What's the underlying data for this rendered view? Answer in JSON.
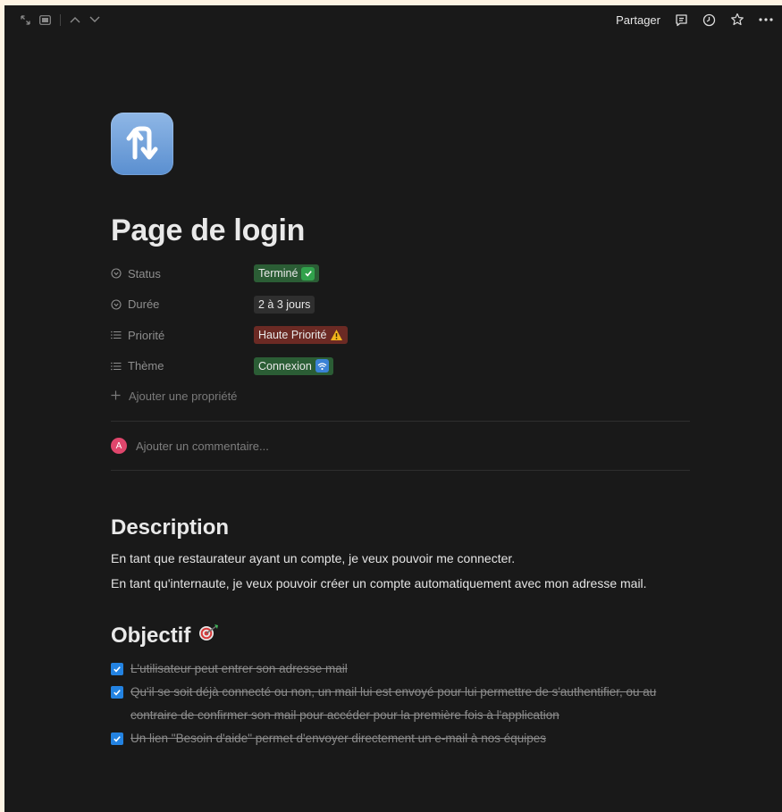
{
  "topbar": {
    "share_label": "Partager",
    "icons": [
      "expand-icon",
      "sidebar-icon",
      "chevron-up-icon",
      "chevron-down-icon",
      "comment-icon",
      "history-icon",
      "star-icon",
      "more-icon"
    ]
  },
  "page": {
    "icon": "repeat-arrows-icon",
    "title": "Page de login"
  },
  "properties": [
    {
      "name": "Status",
      "icon": "status-icon",
      "value": "Terminé",
      "emoji": "✓",
      "tag_color": "#2b5d35",
      "emoji_color": "#31a24c"
    },
    {
      "name": "Durée",
      "icon": "status-icon",
      "value": "2 à 3 jours",
      "emoji": "",
      "tag_color": "#2f2f2f",
      "emoji_color": ""
    },
    {
      "name": "Priorité",
      "icon": "list-icon",
      "value": "Haute Priorité",
      "emoji": "⚠",
      "tag_color": "#6b2a24",
      "emoji_color": "#f2b41c"
    },
    {
      "name": "Thème",
      "icon": "list-icon",
      "value": "Connexion",
      "emoji": "wifi",
      "tag_color": "#2b5d35",
      "emoji_color": "#3b82d6"
    }
  ],
  "add_property_label": "Ajouter une propriété",
  "comment": {
    "avatar_initial": "A",
    "placeholder": "Ajouter un commentaire..."
  },
  "description": {
    "heading": "Description",
    "lines": [
      "En tant que restaurateur ayant un compte, je veux pouvoir me connecter.",
      "En tant qu'internaute, je veux pouvoir créer un compte automatiquement avec mon adresse mail."
    ]
  },
  "objectif": {
    "heading": "Objectif",
    "heading_emoji": "target-icon",
    "todos": [
      {
        "text": "L'utilisateur peut entrer son adresse mail",
        "checked": true
      },
      {
        "text": "Qu'il se soit déjà connecté ou non, un mail lui est envoyé pour lui permettre de s'authentifier, ou au contraire de confirmer son mail pour accéder pour la première fois à l'application",
        "checked": true
      },
      {
        "text": "Un lien \"Besoin d'aide\" permet d'envoyer directement un e-mail à nos équipes",
        "checked": true
      }
    ]
  },
  "colors": {
    "background": "#191919",
    "accent": "#2383e2"
  }
}
